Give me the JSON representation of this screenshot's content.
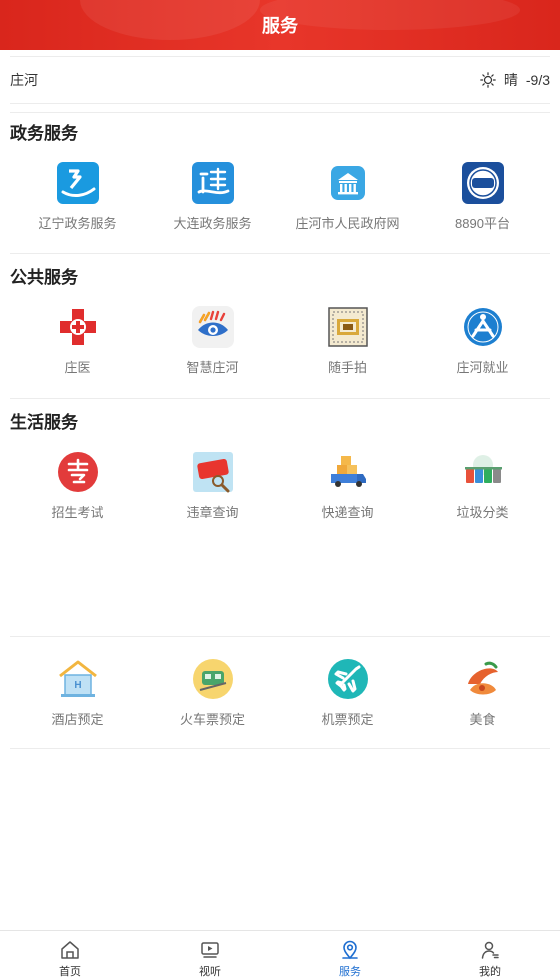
{
  "header": {
    "title": "服务"
  },
  "weather": {
    "location": "庄河",
    "condition": "晴",
    "temperature": "-9/3"
  },
  "sections": [
    {
      "title": "政务服务",
      "items": [
        {
          "label": "辽宁政务服务",
          "icon": "liaoning-gov-icon"
        },
        {
          "label": "大连政务服务",
          "icon": "dalian-gov-icon"
        },
        {
          "label": "庄河市人民政府网",
          "icon": "government-building-icon"
        },
        {
          "label": "8890平台",
          "icon": "8890-platform-icon"
        }
      ]
    },
    {
      "title": "公共服务",
      "items": [
        {
          "label": "庄医",
          "icon": "medical-cross-icon"
        },
        {
          "label": "智慧庄河",
          "icon": "smart-eye-icon"
        },
        {
          "label": "随手拍",
          "icon": "camera-shot-icon"
        },
        {
          "label": "庄河就业",
          "icon": "employment-icon"
        }
      ]
    },
    {
      "title": "生活服务",
      "items": [
        {
          "label": "招生考试",
          "icon": "exam-icon"
        },
        {
          "label": "违章查询",
          "icon": "traffic-violation-icon"
        },
        {
          "label": "快递查询",
          "icon": "delivery-truck-icon"
        },
        {
          "label": "垃圾分类",
          "icon": "recycle-bins-icon"
        }
      ]
    }
  ],
  "travel": {
    "items": [
      {
        "label": "酒店预定",
        "icon": "hotel-icon"
      },
      {
        "label": "火车票预定",
        "icon": "train-icon"
      },
      {
        "label": "机票预定",
        "icon": "airplane-icon"
      },
      {
        "label": "美食",
        "icon": "food-icon"
      }
    ]
  },
  "tabbar": {
    "items": [
      {
        "label": "首页",
        "icon": "home-icon"
      },
      {
        "label": "视听",
        "icon": "tv-icon"
      },
      {
        "label": "服务",
        "icon": "location-service-icon"
      },
      {
        "label": "我的",
        "icon": "user-icon"
      }
    ]
  },
  "colors": {
    "header_red": "#e02d22",
    "active_tab": "#1f6fd1"
  }
}
